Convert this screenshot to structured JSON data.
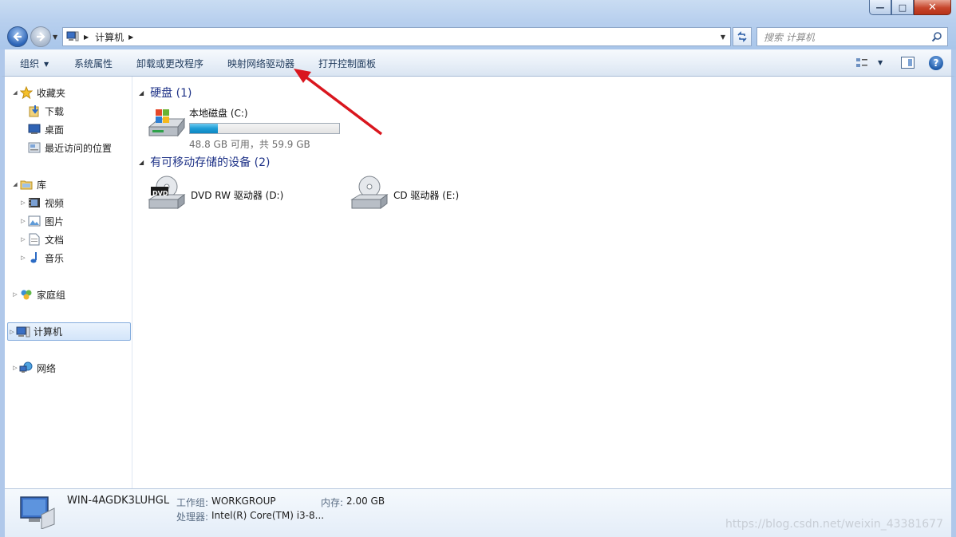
{
  "window": {
    "minimize_glyph": "—",
    "maximize_glyph": "□",
    "close_glyph": "✕"
  },
  "nav": {
    "crumb": "计算机",
    "search_placeholder": "搜索 计算机"
  },
  "toolbar": {
    "organize": "组织",
    "system_properties": "系统属性",
    "uninstall": "卸载或更改程序",
    "map_drive": "映射网络驱动器",
    "control_panel": "打开控制面板",
    "help_glyph": "?"
  },
  "navpane": {
    "favorites": "收藏夹",
    "downloads": "下载",
    "desktop": "桌面",
    "recent": "最近访问的位置",
    "libraries": "库",
    "videos": "视频",
    "pictures": "图片",
    "documents": "文档",
    "music": "音乐",
    "homegroup": "家庭组",
    "computer": "计算机",
    "network": "网络"
  },
  "content": {
    "hdd_group": "硬盘 (1)",
    "removable_group": "有可移动存储的设备 (2)",
    "drives": [
      {
        "name": "本地磁盘 (C:)",
        "free_text": "48.8 GB 可用，共 59.9 GB",
        "used_fraction": 0.185
      },
      {
        "name": "DVD RW 驱动器 (D:)",
        "badge": "DVD"
      },
      {
        "name": "CD 驱动器 (E:)"
      }
    ]
  },
  "details": {
    "computer_name": "WIN-4AGDK3LUHGL",
    "workgroup_label": "工作组:",
    "workgroup_value": "WORKGROUP",
    "memory_label": "内存:",
    "memory_value": "2.00 GB",
    "cpu_label": "处理器:",
    "cpu_value": "Intel(R) Core(TM) i3-8...",
    "watermark": "https://blog.csdn.net/weixin_43381677"
  },
  "colors": {
    "accent": "#1e3287",
    "annotation_arrow": "#d9161e",
    "bar_fill": "#1f9dd6"
  }
}
